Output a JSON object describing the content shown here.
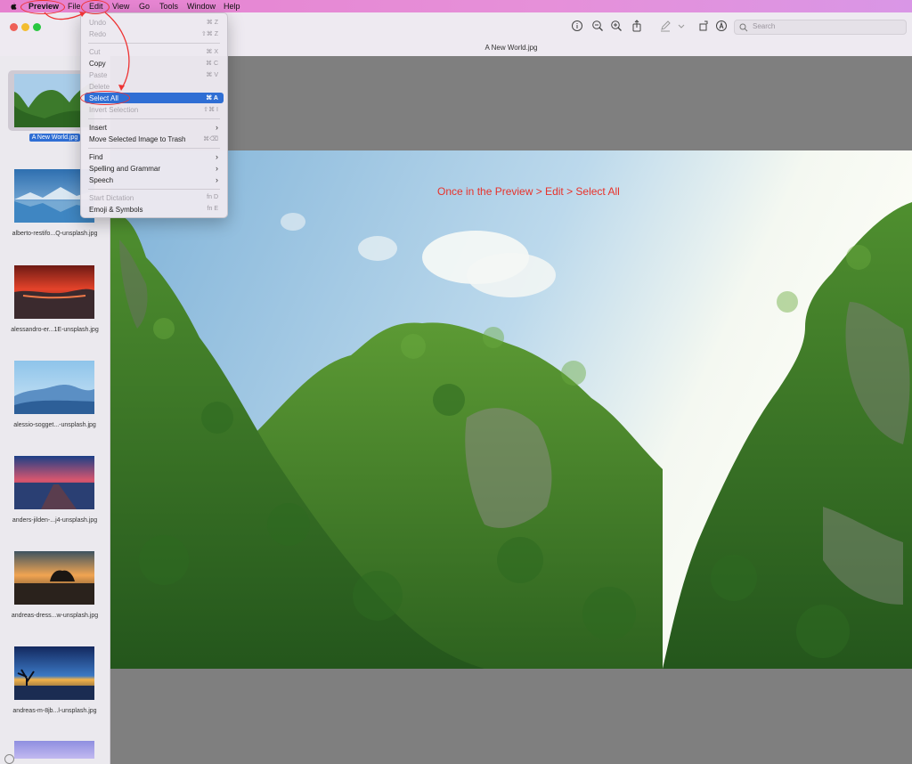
{
  "menubar": {
    "items": [
      "Preview",
      "File",
      "Edit",
      "View",
      "Go",
      "Tools",
      "Window",
      "Help"
    ]
  },
  "toolbar": {
    "document_title": "A New World.jpg",
    "search_placeholder": "Search",
    "icons": [
      "info-icon",
      "zoom-out-icon",
      "zoom-in-icon",
      "share-icon",
      "markup-pen-icon",
      "chevron-down-icon",
      "rotate-icon",
      "annotate-icon",
      "search-icon"
    ]
  },
  "edit_menu": {
    "items": [
      {
        "label": "Undo",
        "shortcut": "⌘ Z",
        "enabled": false
      },
      {
        "label": "Redo",
        "shortcut": "⇧⌘ Z",
        "enabled": false
      },
      {
        "label": "Cut",
        "shortcut": "⌘ X",
        "enabled": false
      },
      {
        "label": "Copy",
        "shortcut": "⌘ C",
        "enabled": true
      },
      {
        "label": "Paste",
        "shortcut": "⌘ V",
        "enabled": false
      },
      {
        "label": "Delete",
        "shortcut": "",
        "enabled": false
      },
      {
        "label": "Select All",
        "shortcut": "⌘ A",
        "enabled": true,
        "highlighted": true
      },
      {
        "label": "Invert Selection",
        "shortcut": "⇧⌘ I",
        "enabled": false
      },
      {
        "label": "Insert",
        "submenu": true,
        "enabled": true
      },
      {
        "label": "Move Selected Image to Trash",
        "shortcut": "⌘⌫",
        "enabled": true
      },
      {
        "label": "Find",
        "submenu": true,
        "enabled": true
      },
      {
        "label": "Spelling and Grammar",
        "submenu": true,
        "enabled": true
      },
      {
        "label": "Speech",
        "submenu": true,
        "enabled": true
      },
      {
        "label": "Start Dictation",
        "shortcut": "fn D",
        "enabled": false
      },
      {
        "label": "Emoji & Symbols",
        "shortcut": "fn E",
        "enabled": true
      }
    ]
  },
  "sidebar": {
    "thumbnails": [
      {
        "label": "A New World.jpg",
        "selected": true
      },
      {
        "label": "alberto-restifo...Q-unsplash.jpg"
      },
      {
        "label": "alessandro-er...1E-unsplash.jpg"
      },
      {
        "label": "alessio-sogget...-unsplash.jpg"
      },
      {
        "label": "anders-jilden-...j4-unsplash.jpg"
      },
      {
        "label": "andreas-dress...w-unsplash.jpg"
      },
      {
        "label": "andreas-m-8jb...l-unsplash.jpg"
      }
    ]
  },
  "annotation": {
    "text": "Once in the Preview > Edit > Select All",
    "color": "#e8322a"
  },
  "colors": {
    "menubar": "#e690d9",
    "highlight": "#2f6ed4",
    "canvas": "#7f7f7f"
  }
}
